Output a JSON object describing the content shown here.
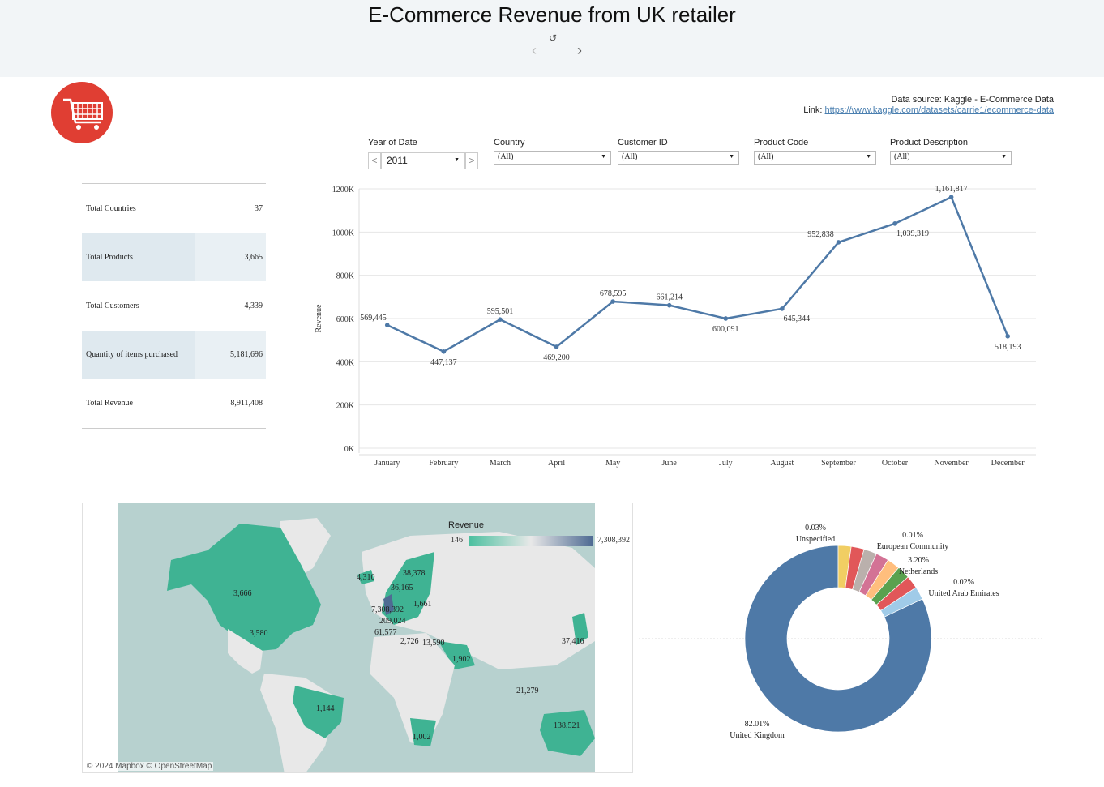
{
  "header": {
    "title": "E-Commerce Revenue from UK retailer",
    "revert_icon": "↺",
    "prev_icon": "‹",
    "next_icon": "›"
  },
  "logo": {
    "icon": "shopping-cart-icon",
    "color": "#e03e33"
  },
  "source": {
    "line1": "Data source: Kaggle - E-Commerce Data",
    "link_prefix": "Link: ",
    "link_text": "https://www.kaggle.com/datasets/carrie1/ecommerce-data"
  },
  "filters": {
    "year": {
      "label": "Year of Date",
      "value": "2011",
      "prev": "<",
      "next": ">"
    },
    "country": {
      "label": "Country",
      "value": "(All)"
    },
    "customer": {
      "label": "Customer ID",
      "value": "(All)"
    },
    "product_code": {
      "label": "Product Code",
      "value": "(All)"
    },
    "product_description": {
      "label": "Product Description",
      "value": "(All)"
    }
  },
  "kpis": [
    {
      "label": "Total Countries",
      "value": "37"
    },
    {
      "label": "Total Products",
      "value": "3,665"
    },
    {
      "label": "Total Customers",
      "value": "4,339"
    },
    {
      "label": "Quantity of items purchased",
      "value": "5,181,696"
    },
    {
      "label": "Total Revenue",
      "value": "8,911,408"
    }
  ],
  "chart_data": [
    {
      "type": "line",
      "ylabel": "Revenue",
      "ylim": [
        0,
        1200000
      ],
      "yticks": [
        "0K",
        "200K",
        "400K",
        "600K",
        "800K",
        "1000K",
        "1200K"
      ],
      "grid": true,
      "color": "#4e79a7",
      "categories": [
        "January",
        "February",
        "March",
        "April",
        "May",
        "June",
        "July",
        "August",
        "September",
        "October",
        "November",
        "December"
      ],
      "values": [
        569445,
        447137,
        595501,
        469200,
        678595,
        661214,
        600091,
        645344,
        952838,
        1039319,
        1161817,
        518193
      ],
      "labels": [
        "569,445",
        "447,137",
        "595,501",
        "469,200",
        "678,595",
        "661,214",
        "600,091",
        "645,344",
        "952,838",
        "1,039,319",
        "1,161,817",
        "518,193"
      ]
    },
    {
      "type": "pie",
      "donut": true,
      "slices": [
        {
          "name": "United Kingdom",
          "percent": 82.01,
          "label": "82.01%",
          "color": "#4e79a7"
        },
        {
          "name": "Unspecified",
          "percent": 0.03,
          "label": "0.03%",
          "color": "#d4a6c8"
        },
        {
          "name": "European Community",
          "percent": 0.01,
          "label": "0.01%",
          "color": "#86bcb6"
        },
        {
          "name": "Netherlands",
          "percent": 3.2,
          "label": "3.20%",
          "color": "#ff9d9a"
        },
        {
          "name": "United Arab Emirates",
          "percent": 0.02,
          "label": "0.02%",
          "color": "#9c755f"
        }
      ]
    }
  ],
  "map": {
    "legend_title": "Revenue",
    "legend_min": "146",
    "legend_max": "7,308,392",
    "credit": "© 2024 Mapbox  © OpenStreetMap",
    "labels": [
      "3,666",
      "3,580",
      "1,144",
      "4,310",
      "38,378",
      "36,165",
      "7,308,392",
      "1,661",
      "209,024",
      "61,577",
      "2,726",
      "13,590",
      "1,902",
      "37,416",
      "21,279",
      "1,002",
      "138,521"
    ]
  }
}
